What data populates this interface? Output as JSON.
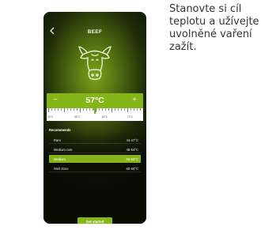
{
  "app": {
    "title": "BEEF",
    "back_icon": "chevron-left-icon",
    "illustration": "cow-head-icon",
    "accent_color": "#86b519"
  },
  "temperature": {
    "value": "57°C",
    "minus_label": "−",
    "plus_label": "+",
    "scale_labels": [
      "50°C",
      "55°C",
      "60°C",
      "70°C"
    ]
  },
  "recommends": {
    "title": "Recommends",
    "items": [
      {
        "name": "Rare",
        "range": "44-47°C",
        "selected": false
      },
      {
        "name": "Medium rare",
        "range": "48-54°C",
        "selected": false
      },
      {
        "name": "Medium",
        "range": "55-59°C",
        "selected": true
      },
      {
        "name": "Well done",
        "range": "60-60°C",
        "selected": false
      }
    ]
  },
  "cta": {
    "label": "Get started"
  },
  "side_text": {
    "lines": [
      "Stanovte si cíl",
      "teplotu a užívejte",
      "uvolněné vaření",
      "zažít."
    ]
  }
}
